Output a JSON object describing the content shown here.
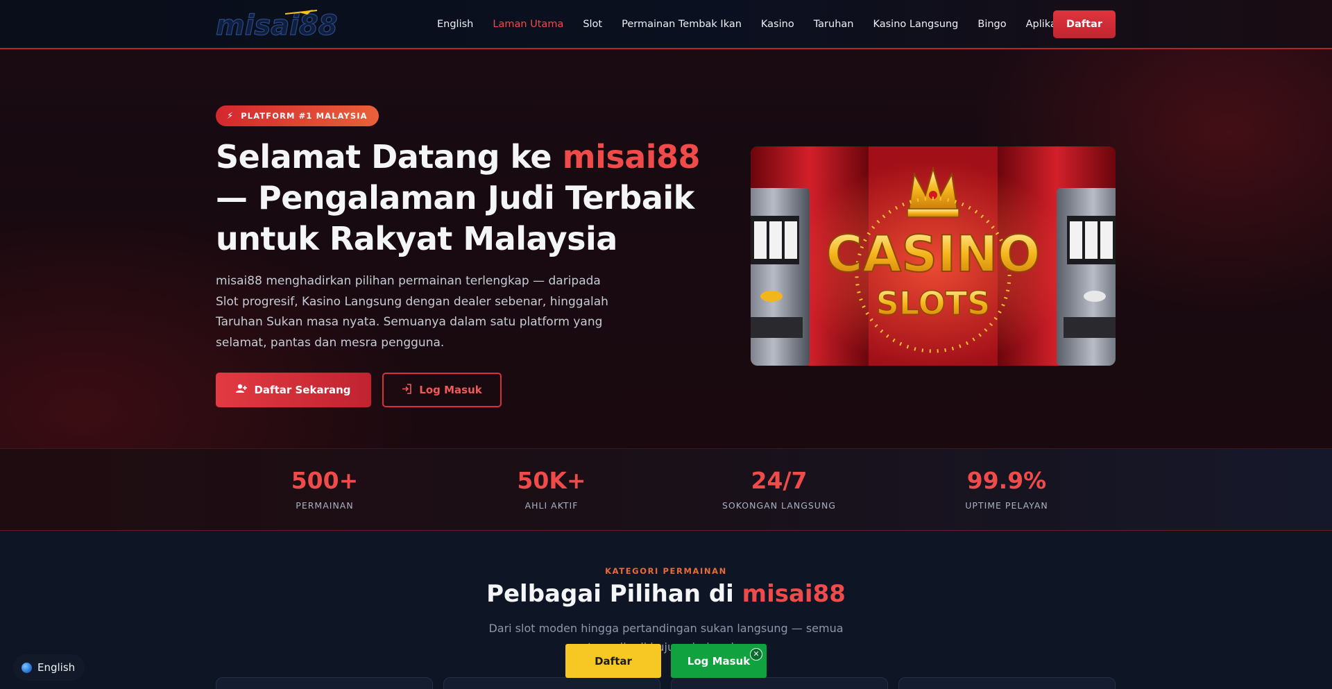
{
  "colors": {
    "accent": "#ef4b4b",
    "accent_dark": "#c22531",
    "eyebrow": "#ea6a3a",
    "float_yellow": "#f7c824",
    "float_green": "#11a240"
  },
  "header": {
    "logo_text": "misai88",
    "nav": [
      {
        "label": "English"
      },
      {
        "label": "Laman Utama",
        "active": true
      },
      {
        "label": "Slot"
      },
      {
        "label": "Permainan Tembak Ikan"
      },
      {
        "label": "Kasino"
      },
      {
        "label": "Taruhan"
      },
      {
        "label": "Kasino Langsung"
      },
      {
        "label": "Bingo"
      },
      {
        "label": "Aplikasi"
      }
    ],
    "cta_label": "Daftar"
  },
  "hero": {
    "badge": {
      "icon": "bolt-icon",
      "label": "PLATFORM #1 MALAYSIA"
    },
    "title_prefix": "Selamat Datang ke ",
    "title_brand": "misai88",
    "title_suffix": " — Pengalaman Judi Terbaik untuk Rakyat Malaysia",
    "description": "misai88 menghadirkan pilihan permainan terlengkap — daripada Slot progresif, Kasino Langsung dengan dealer sebenar, hinggalah Taruhan Sukan masa nyata. Semuanya dalam satu platform yang selamat, pantas dan mesra pengguna.",
    "primary_button": {
      "icon": "user-plus-icon",
      "label": "Daftar Sekarang"
    },
    "secondary_button": {
      "icon": "login-icon",
      "label": "Log Masuk"
    },
    "image": {
      "line1": "CASINO",
      "line2": "SLOTS"
    }
  },
  "stats": [
    {
      "value": "500+",
      "label": "PERMAINAN"
    },
    {
      "value": "50K+",
      "label": "AHLI AKTIF"
    },
    {
      "value": "24/7",
      "label": "SOKONGAN LANGSUNG"
    },
    {
      "value": "99.9%",
      "label": "UPTIME PELAYAN"
    }
  ],
  "categories": {
    "eyebrow": "KATEGORI PERMAINAN",
    "title_prefix": "Pelbagai Pilihan di ",
    "title_brand": "misai88",
    "subtitle": "Dari slot moden hingga pertandingan sukan langsung — semua tersedia di hujung jari anda."
  },
  "floating": {
    "language": {
      "icon": "globe-icon",
      "label": "English"
    },
    "daftar_label": "Daftar",
    "login_label": "Log Masuk",
    "close_icon": "close-icon"
  }
}
